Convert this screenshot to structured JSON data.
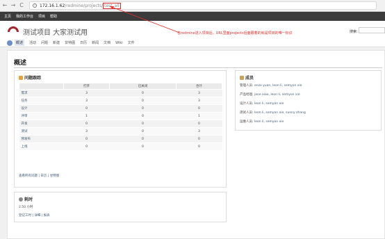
{
  "browser": {
    "back": "←",
    "forward": "→",
    "reload": "C",
    "info_icon": "i",
    "host": "172.16.1.62",
    "path": "/redmine/projects/",
    "identifier": "test_all"
  },
  "topmenu": [
    "主页",
    "我的工作台",
    "项目",
    "帮助"
  ],
  "header": {
    "project_title": "测试项目 大家测试用",
    "search_label": "搜索:"
  },
  "annotation": {
    "text": "在redmine进入项目后，URL里面projects后面跟着的就是项目的唯一标识"
  },
  "tabs": [
    "概述",
    "活动",
    "问题",
    "新建",
    "甘特图",
    "日历",
    "新闻",
    "文档",
    "Wiki",
    "文件"
  ],
  "main": {
    "page_title": "概述",
    "issues": {
      "title": "问题跟踪",
      "columns": [
        "",
        "打开",
        "已关闭",
        "合计"
      ],
      "rows": [
        [
          "需求",
          "3",
          "0",
          "3"
        ],
        [
          "任务",
          "3",
          "0",
          "3"
        ],
        [
          "设计",
          "0",
          "0",
          "0"
        ],
        [
          "评审",
          "1",
          "0",
          "1"
        ],
        [
          "开发",
          "0",
          "0",
          "0"
        ],
        [
          "测试",
          "3",
          "0",
          "3"
        ],
        [
          "预发布",
          "0",
          "0",
          "0"
        ],
        [
          "上线",
          "0",
          "0",
          "0"
        ]
      ],
      "links": "查看所有问题 | 日历 | 甘特图"
    },
    "time": {
      "title": "耗时",
      "hours": "2.50 小时",
      "links": "登记工时 | 详细 | 报表"
    },
    "members": {
      "title": "成员",
      "rows": [
        {
          "role": "管理人员:",
          "names": "enzo yuan, leon li, semyon xie"
        },
        {
          "role": "产品经理:",
          "names": "jane xiao, leon li, semyon xie"
        },
        {
          "role": "设计人员:",
          "names": "leon li, semyon xie"
        },
        {
          "role": "测试人员:",
          "names": "leon li, semyon xie, sunny zhang"
        },
        {
          "role": "运维人员:",
          "names": "leon li, semyon xie"
        }
      ]
    }
  },
  "colors": {
    "accent_red": "#e0302c",
    "logo_red": "#a4262c",
    "link": "#3e5b76",
    "topbar": "#3b3b3b"
  }
}
